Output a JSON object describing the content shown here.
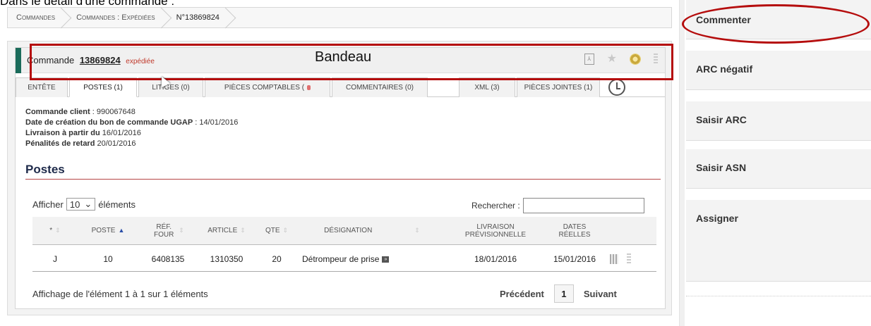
{
  "caption": "Dans le détail d'une commande :",
  "breadcrumb": [
    "Commandes",
    "Commandes : Expédiées",
    "N°13869824"
  ],
  "header": {
    "title_prefix": "Commande",
    "order_number": "13869824",
    "status": "expédiée",
    "annotation_label": "Bandeau"
  },
  "tabs": [
    {
      "label": "Entête",
      "active": false
    },
    {
      "label": "Postes (1)",
      "active": true
    },
    {
      "label": "Litiges (0)",
      "active": false
    },
    {
      "label": "Pièces comptables (",
      "active": false
    },
    {
      "label": "Commentaires (0)",
      "active": false
    },
    {
      "label": "XML (3)",
      "active": false
    },
    {
      "label": "Pièces jointes (1)",
      "active": false
    }
  ],
  "info": {
    "client_label": "Commande client",
    "client_value": " : 990067648",
    "creation_label": "Date de création du bon de commande UGAP",
    "creation_value": " : 14/01/2016",
    "delivery_label": "Livraison à partir du",
    "delivery_value": " 16/01/2016",
    "penalty_label": "Pénalités de retard",
    "penalty_value": " 20/01/2016"
  },
  "postes": {
    "title": "Postes",
    "show_prefix": "Afficher",
    "show_value": "10",
    "show_suffix": "éléments",
    "search_label": "Rechercher :",
    "search_value": "",
    "columns": [
      "*",
      "Poste",
      "Réf. Four",
      "Article",
      "QTE",
      "Désignation",
      "Livraison prévisionnelle",
      "Dates réelles"
    ],
    "rows": [
      {
        "star": "J",
        "poste": "10",
        "ref": "6408135",
        "article": "1310350",
        "qte": "20",
        "designation": "Détrompeur de prise",
        "livraison": "18/01/2016",
        "dates": "15/01/2016"
      }
    ],
    "footer": "Affichage de l'élément 1 à 1 sur 1 éléments",
    "prev": "Précédent",
    "page": "1",
    "next": "Suivant"
  },
  "sidebar": {
    "items": [
      "Commenter",
      "ARC négatif",
      "Saisir ARC",
      "Saisir ASN",
      "Assigner"
    ]
  },
  "colors": {
    "accent_red": "#b50d0d",
    "header_green": "#1a6b5a",
    "status_red": "#c0392b"
  },
  "icons": [
    "pdf-icon",
    "star-icon",
    "gear-icon",
    "grip-icon",
    "history-icon"
  ]
}
